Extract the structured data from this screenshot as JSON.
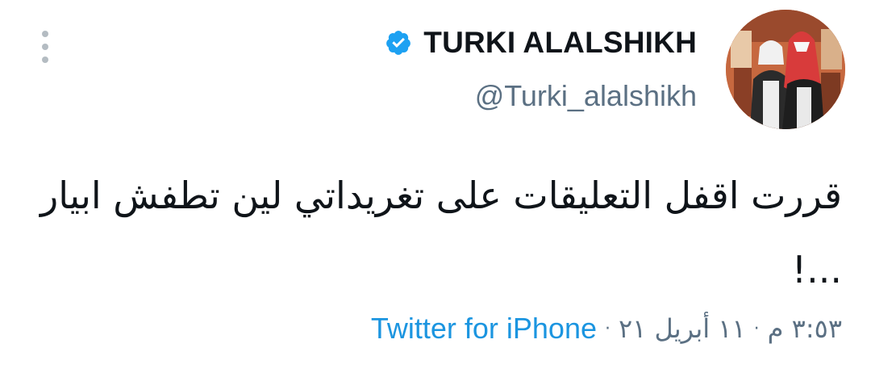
{
  "tweet": {
    "author": {
      "display_name": "TURKI ALALSHIKH",
      "handle": "@Turki_alalshikh",
      "verified": true
    },
    "text": "قررت اقفل التعليقات على تغريداتي لين تطفش ابيار ...!",
    "meta": {
      "time": "٣:٥٣ م",
      "separator": "·",
      "date": "١١ أبريل ٢١",
      "source": "Twitter for iPhone"
    }
  },
  "icons": {
    "more": "more-vertical-icon",
    "verified": "verified-badge-icon"
  },
  "colors": {
    "accent": "#1b95e0",
    "verified": "#1da1f2",
    "secondary_text": "#5b7083",
    "menu_dots": "#b4bcc2"
  }
}
